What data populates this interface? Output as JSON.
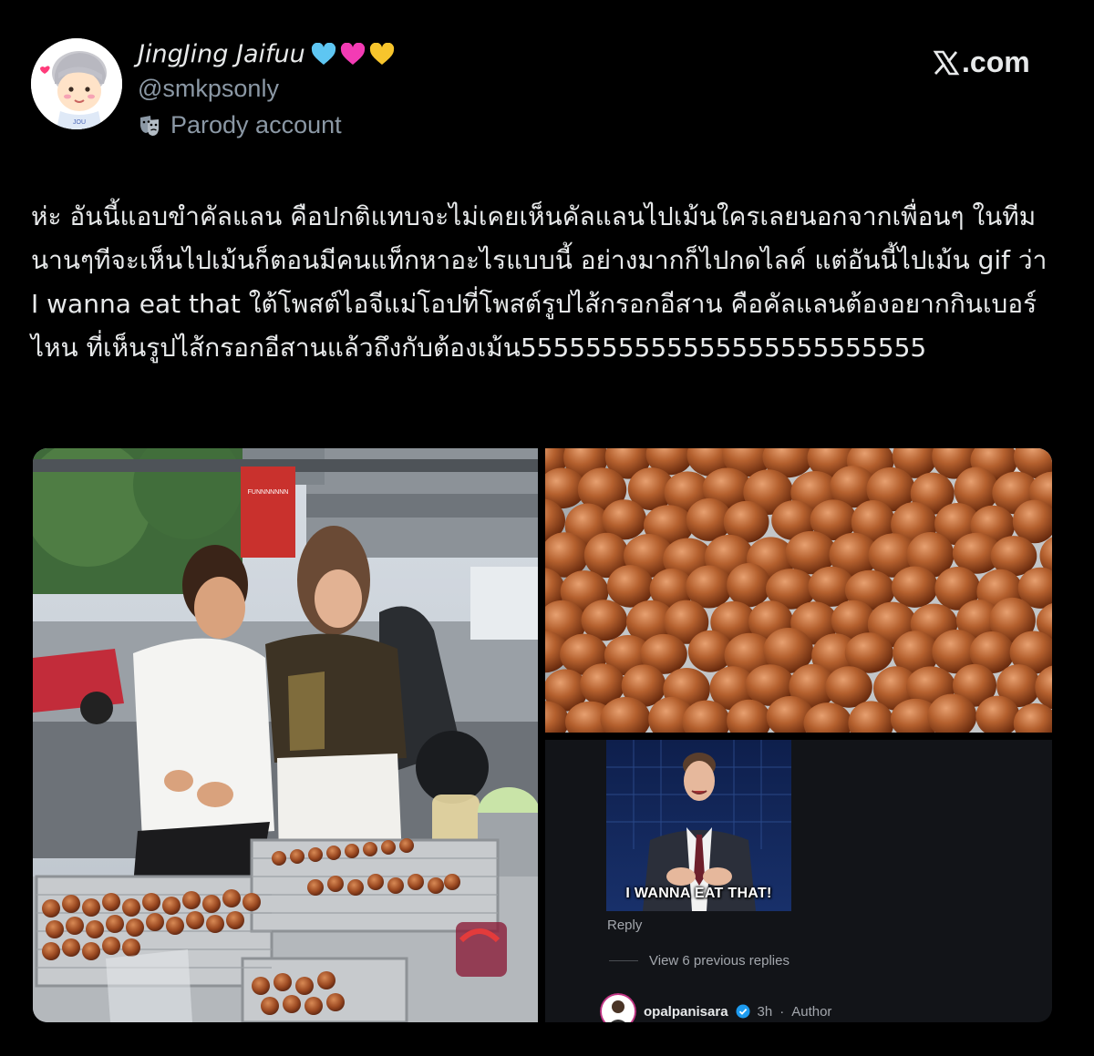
{
  "profile": {
    "display_name": "JingJing Jaifuu",
    "hearts": [
      "light-blue-heart-icon",
      "pink-heart-icon",
      "yellow-heart-icon"
    ],
    "handle": "@smkpsonly",
    "parody_label": "Parody account",
    "avatar_icon": "cartoon-avatar-icon"
  },
  "brand": {
    "site": ".com",
    "logo_icon": "x-logo-icon"
  },
  "tweet": {
    "text": "ห่ะ อันนี้แอบขำคัลแลน คือปกติแทบจะไม่เคยเห็นคัลแลนไปเม้นใครเลยนอกจากเพื่อนๆ ในทีม นานๆทีจะเห็นไปเม้นก็ตอนมีคนแท็กหาอะไรแบบนี้ อย่างมากก็ไปกดไลค์ แต่อันนี้ไปเม้น gif ว่า I wanna eat that ใต้โพสต์ไอจีแม่โอปที่โพสต์รูปไส้กรอกอีสาน คือคัลแลนต้องอยากกินเบอร์ไหน ที่เห็นรูปไส้กรอกอีสานแล้วถึงกับต้องเม้น5555555555555555555555555"
  },
  "media": {
    "photo_1": "street-food-vendor-photo",
    "photo_2": "grilled-isan-sausage-photo",
    "photo_2_sign": "FUNNNNNNN NNNNNNN NNNNN",
    "comment_screenshot": {
      "gif_caption": "I WANNA EAT THAT!",
      "reply_label": "Reply",
      "view_replies": "View 6 previous replies",
      "author": "opalpanisara",
      "time": "3h",
      "author_tag": "Author"
    }
  },
  "colors": {
    "background": "#000000",
    "text_primary": "#e7e9ea",
    "text_secondary": "#8b98a5",
    "verified_blue": "#1d9bf0"
  }
}
